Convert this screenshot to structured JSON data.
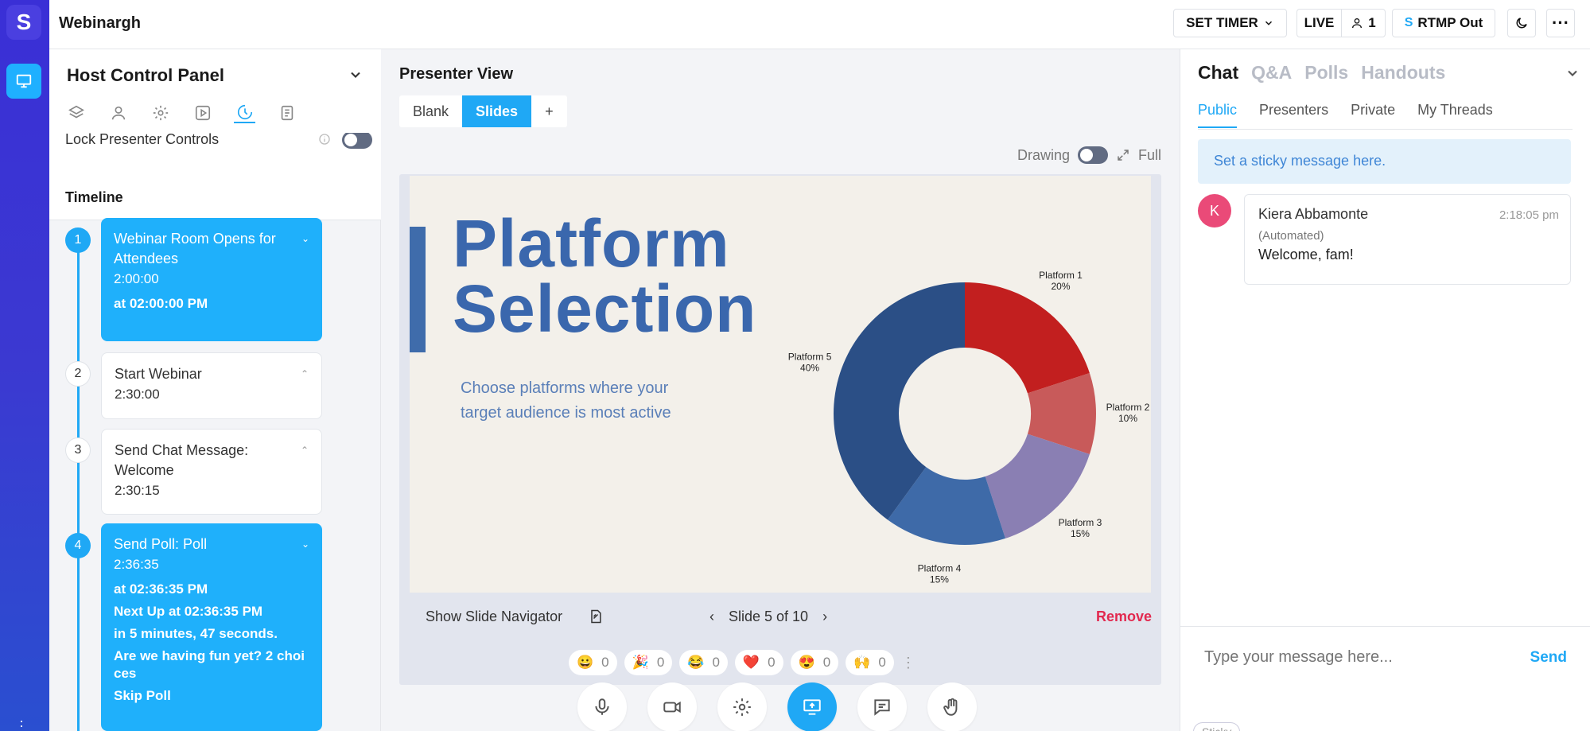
{
  "app": {
    "title": "Webinargh",
    "logo_glyph": "S"
  },
  "topbar": {
    "set_timer": "SET TIMER",
    "live": "LIVE",
    "attendee_count": "1",
    "rtmp_out": "RTMP Out"
  },
  "host_panel": {
    "title": "Host Control Panel",
    "tabs": [
      "layers-icon",
      "user-icon",
      "settings-icon",
      "play-icon",
      "timeline-icon",
      "notes-icon"
    ],
    "active_tab": "timeline-icon",
    "lock_label": "Lock Presenter Controls",
    "timeline_title": "Timeline",
    "items": [
      {
        "num": "1",
        "title": "Webinar Room Opens for Attendees",
        "time": "2:00:00",
        "at": "at 02:00:00 PM"
      },
      {
        "num": "2",
        "title": "Start Webinar",
        "time": "2:30:00"
      },
      {
        "num": "3",
        "title": "Send Chat Message: Welcome",
        "time": "2:30:15"
      },
      {
        "num": "4",
        "title": "Send Poll: Poll",
        "time": "2:36:35",
        "at": "at 02:36:35 PM",
        "next": "Next Up at 02:36:35 PM",
        "countdown": "in 5 minutes, 47 seconds.",
        "question": "Are we having fun yet? 2 choices",
        "skip": "Skip Poll"
      }
    ]
  },
  "presenter": {
    "title": "Presenter View",
    "modes": [
      "Blank",
      "Slides",
      "+"
    ],
    "active_mode": "Slides",
    "drawing_label": "Drawing",
    "full_label": "Full",
    "slide": {
      "title_line1": "Platform",
      "title_line2": "Selection",
      "body": "Choose platforms where your target audience is most active"
    },
    "show_navigator": "Show Slide Navigator",
    "slide_counter": "Slide 5 of 10",
    "remove": "Remove",
    "reactions": [
      {
        "emoji": "😀",
        "count": "0"
      },
      {
        "emoji": "🎉",
        "count": "0"
      },
      {
        "emoji": "😂",
        "count": "0"
      },
      {
        "emoji": "❤️",
        "count": "0"
      },
      {
        "emoji": "😍",
        "count": "0"
      },
      {
        "emoji": "🙌",
        "count": "0"
      }
    ]
  },
  "chart_data": {
    "type": "pie",
    "categories": [
      "Platform 1",
      "Platform 2",
      "Platform 3",
      "Platform 4",
      "Platform 5"
    ],
    "values": [
      20,
      10,
      15,
      15,
      40
    ],
    "value_labels": [
      "20%",
      "10%",
      "15%",
      "15%",
      "40%"
    ],
    "colors": [
      "#c21f1f",
      "#c85a5a",
      "#8a7fb3",
      "#3e6aa8",
      "#2b4f86"
    ],
    "donut": true
  },
  "chat": {
    "tabs": [
      "Chat",
      "Q&A",
      "Polls",
      "Handouts"
    ],
    "active_tab": "Chat",
    "subtabs": [
      "Public",
      "Presenters",
      "Private",
      "My Threads"
    ],
    "active_subtab": "Public",
    "sticky_placeholder": "Set a sticky message here.",
    "messages": [
      {
        "initial": "K",
        "name": "Kiera Abbamonte",
        "time": "2:18:05 pm",
        "meta": "(Automated)",
        "text": "Welcome, fam!"
      }
    ],
    "input_placeholder": "Type your message here...",
    "send": "Send",
    "sticky_pill": "Sticky"
  }
}
